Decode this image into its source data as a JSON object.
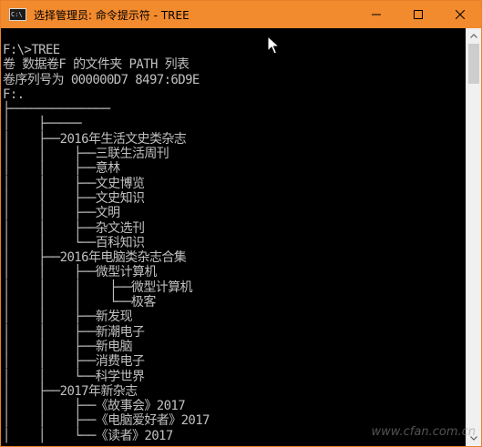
{
  "window": {
    "title": "选择管理员: 命令提示符 - TREE",
    "icon": "cmd-app-icon",
    "icon_text": "C:\\",
    "colors": {
      "titlebar": "#f28a2e",
      "console_bg": "#000000",
      "console_text": "#c0c0c0"
    }
  },
  "controls": {
    "minimize_icon": "minimize-icon",
    "maximize_icon": "maximize-icon",
    "close_icon": "close-icon"
  },
  "console": {
    "lines": [
      "F:\\>TREE",
      "卷 数据卷F 的文件夹 PATH 列表",
      "卷序列号为 000000D7 8497:6D9E",
      "F:.",
      "├──────────────",
      "│    ├─────",
      "│    ├──2016年生活文史类杂志",
      "│    │    ├──三联生活周刊",
      "│    │    ├──意林",
      "│    │    ├──文史博览",
      "│    │    ├──文史知识",
      "│    │    ├──文明",
      "│    │    ├──杂文选刊",
      "│    │    └──百科知识",
      "│    ├──2016年电脑类杂志合集",
      "│    │    ├──微型计算机",
      "│    │    │    ├──微型计算机",
      "│    │    │    └──极客",
      "│    │    ├──新发现",
      "│    │    ├──新潮电子",
      "│    │    ├──新电脑",
      "│    │    ├──消费电子",
      "│    │    └──科学世界",
      "│    ├──2017年新杂志",
      "│    │    ├──《故事会》2017",
      "│    │    ├──《电脑爱好者》2017",
      "│    │    └──《读者》2017"
    ]
  },
  "scrollbar": {
    "up_icon": "scroll-up-arrow-icon",
    "down_icon": "scroll-down-arrow-icon"
  },
  "watermark": "www.cfan.com.cn"
}
